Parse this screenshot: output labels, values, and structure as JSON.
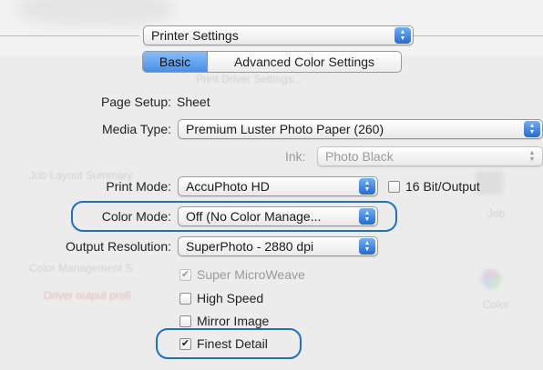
{
  "header": {
    "panel_popup": "Printer Settings"
  },
  "tabs": [
    {
      "label": "Basic",
      "selected": true
    },
    {
      "label": "Advanced Color Settings",
      "selected": false
    }
  ],
  "form": {
    "page_setup": {
      "label": "Page Setup:",
      "value": "Sheet"
    },
    "media_type": {
      "label": "Media Type:",
      "value": "Premium Luster Photo Paper (260)"
    },
    "ink": {
      "label": "Ink:",
      "value": "Photo Black"
    },
    "print_mode": {
      "label": "Print Mode:",
      "value": "AccuPhoto HD"
    },
    "bit_output": {
      "label": "16 Bit/Output",
      "checked": false
    },
    "color_mode": {
      "label": "Color Mode:",
      "value": "Off (No Color Manage..."
    },
    "output_resolution": {
      "label": "Output Resolution:",
      "value": "SuperPhoto - 2880 dpi"
    },
    "options": [
      {
        "label": "Super MicroWeave",
        "checked": true,
        "disabled": true
      },
      {
        "label": "High Speed",
        "checked": false,
        "disabled": false
      },
      {
        "label": "Mirror Image",
        "checked": false,
        "disabled": false
      },
      {
        "label": "Finest Detail",
        "checked": true,
        "disabled": false
      }
    ]
  },
  "background_ghosts": {
    "print_driver_settings": "Print Driver Settings...",
    "job_layout_summary": "Job Layout Summary",
    "color_management": "Color Management S",
    "driver_output_profile": "Driver output profi",
    "job_label": "Job",
    "color_label": "Color"
  },
  "colors": {
    "highlight": "#1f6fc6",
    "stepper": "#2469d8",
    "background": "#ececec"
  },
  "icons": {
    "stepper": "up-down-arrows",
    "checkbox": "checkmark"
  }
}
